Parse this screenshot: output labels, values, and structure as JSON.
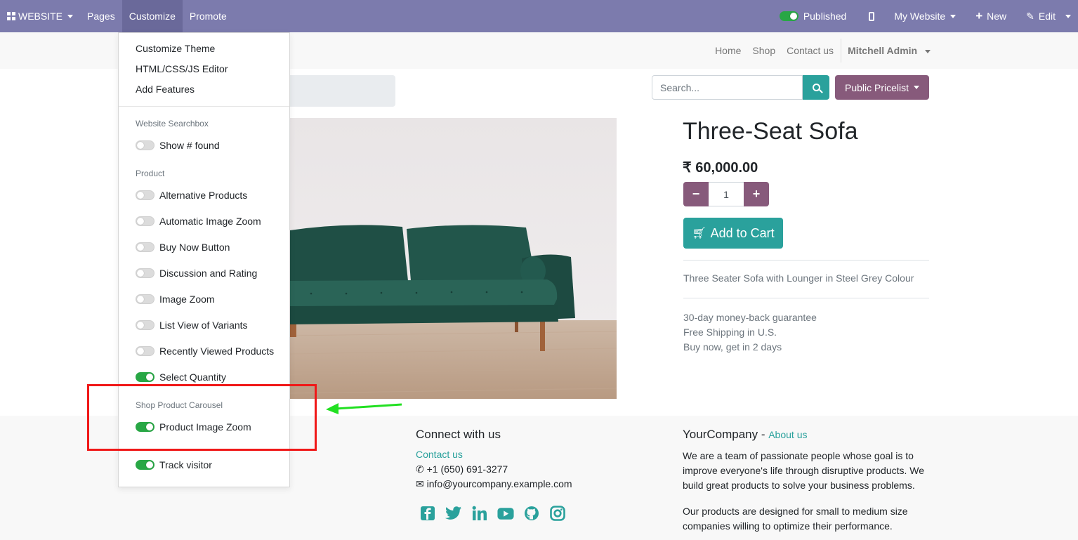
{
  "adminbar": {
    "website_label": "WEBSITE",
    "pages_label": "Pages",
    "customize_label": "Customize",
    "promote_label": "Promote",
    "published_label": "Published",
    "my_website_label": "My Website",
    "new_label": "New",
    "edit_label": "Edit"
  },
  "site_nav": {
    "items": [
      "Home",
      "Shop",
      "Contact us"
    ],
    "user": "Mitchell Admin"
  },
  "search": {
    "placeholder": "Search..."
  },
  "pricelist_label": "Public Pricelist",
  "product": {
    "title": "Three-Seat Sofa",
    "price": "₹ 60,000.00",
    "quantity": "1",
    "add_to_cart": "Add to Cart",
    "description": "Three Seater Sofa with Lounger in Steel Grey Colour",
    "perks": [
      "30-day money-back guarantee",
      "Free Shipping in U.S.",
      "Buy now, get in 2 days"
    ]
  },
  "footer": {
    "connect_title": "Connect with us",
    "contact_link": "Contact us",
    "phone": "+1 (650) 691-3277",
    "email": "info@yourcompany.example.com",
    "company_name": "YourCompany",
    "company_sep": " - ",
    "about_link": "About us",
    "about_text": "We are a team of passionate people whose goal is to improve everyone's life through disruptive products. We build great products to solve your business problems.",
    "about_text2": "Our products are designed for small to medium size companies willing to optimize their performance."
  },
  "customize_menu": {
    "top_items": [
      "Customize Theme",
      "HTML/CSS/JS Editor",
      "Add Features"
    ],
    "section_searchbox": "Website Searchbox",
    "show_found": "Show # found",
    "section_product": "Product",
    "product_toggles": [
      {
        "label": "Alternative Products",
        "on": false
      },
      {
        "label": "Automatic Image Zoom",
        "on": false
      },
      {
        "label": "Buy Now Button",
        "on": false
      },
      {
        "label": "Discussion and Rating",
        "on": false
      },
      {
        "label": "Image Zoom",
        "on": false
      },
      {
        "label": "List View of Variants",
        "on": false
      },
      {
        "label": "Recently Viewed Products",
        "on": false
      },
      {
        "label": "Select Quantity",
        "on": true
      }
    ],
    "section_carousel": "Shop Product Carousel",
    "product_image_zoom": "Product Image Zoom",
    "track_visitor": "Track visitor"
  },
  "colors": {
    "adminbar": "#7c7bad",
    "teal": "#2aa19c",
    "purple": "#875a7b",
    "toggle_on": "#28a745",
    "annotation_red": "#f01818",
    "annotation_green": "#22e022"
  }
}
